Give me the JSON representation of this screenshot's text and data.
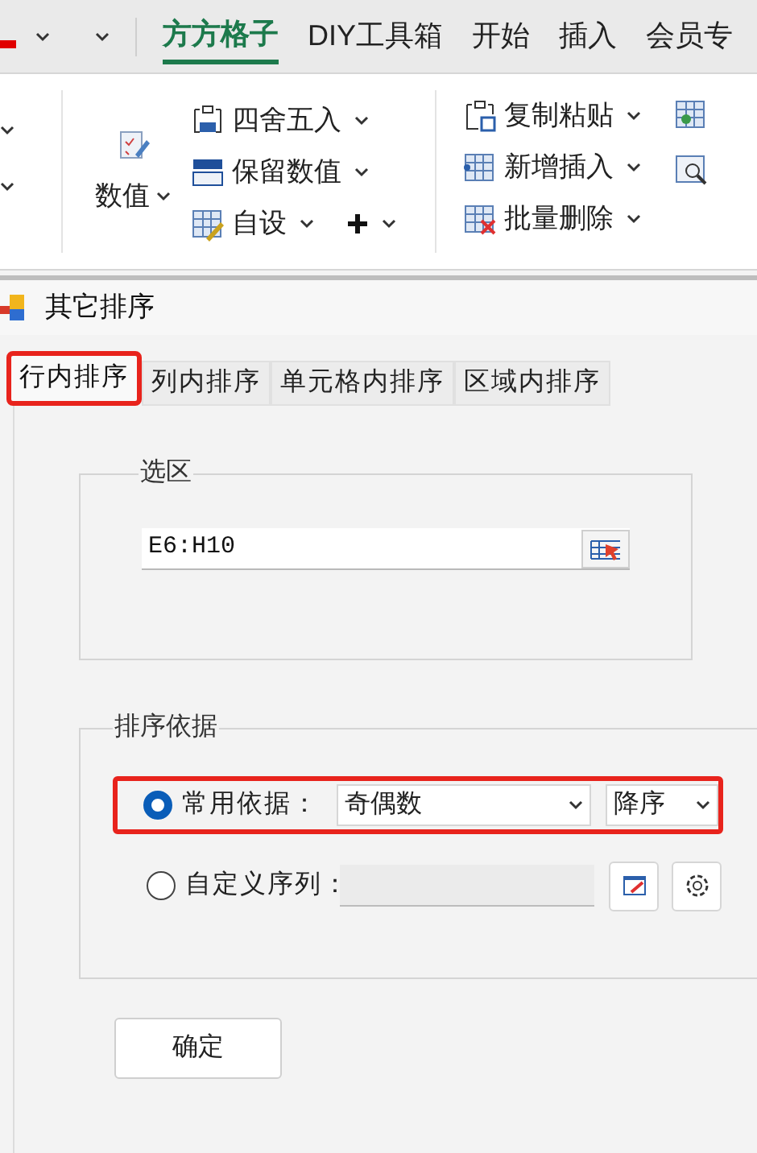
{
  "top_tabs": [
    {
      "label": "方方格子",
      "selected": true
    },
    {
      "label": "DIY工具箱",
      "selected": false
    },
    {
      "label": "开始",
      "selected": false
    },
    {
      "label": "插入",
      "selected": false
    },
    {
      "label": "会员专",
      "selected": false
    }
  ],
  "ribbon": {
    "value_button": "数值",
    "rounding": "四舍五入",
    "keep_values": "保留数值",
    "custom": "自设",
    "copy_paste": "复制粘贴",
    "insert_new": "新增插入",
    "batch_delete": "批量删除"
  },
  "dialog": {
    "title": "其它排序",
    "tabs": [
      {
        "label": "行内排序",
        "selected": true,
        "highlighted": true
      },
      {
        "label": "列内排序",
        "selected": false,
        "highlighted": false
      },
      {
        "label": "单元格内排序",
        "selected": false,
        "highlighted": false
      },
      {
        "label": "区域内排序",
        "selected": false,
        "highlighted": false
      }
    ],
    "selection_group": {
      "title": "选区",
      "value": "E6:H10"
    },
    "sort_group": {
      "title": "排序依据",
      "options": [
        {
          "kind": "common",
          "label": "常用依据：",
          "selected": true,
          "highlighted": true,
          "basis": "奇偶数",
          "order": "降序"
        },
        {
          "kind": "custom",
          "label": "自定义序列：",
          "selected": false,
          "highlighted": false
        }
      ]
    },
    "ok_button": "确定"
  }
}
